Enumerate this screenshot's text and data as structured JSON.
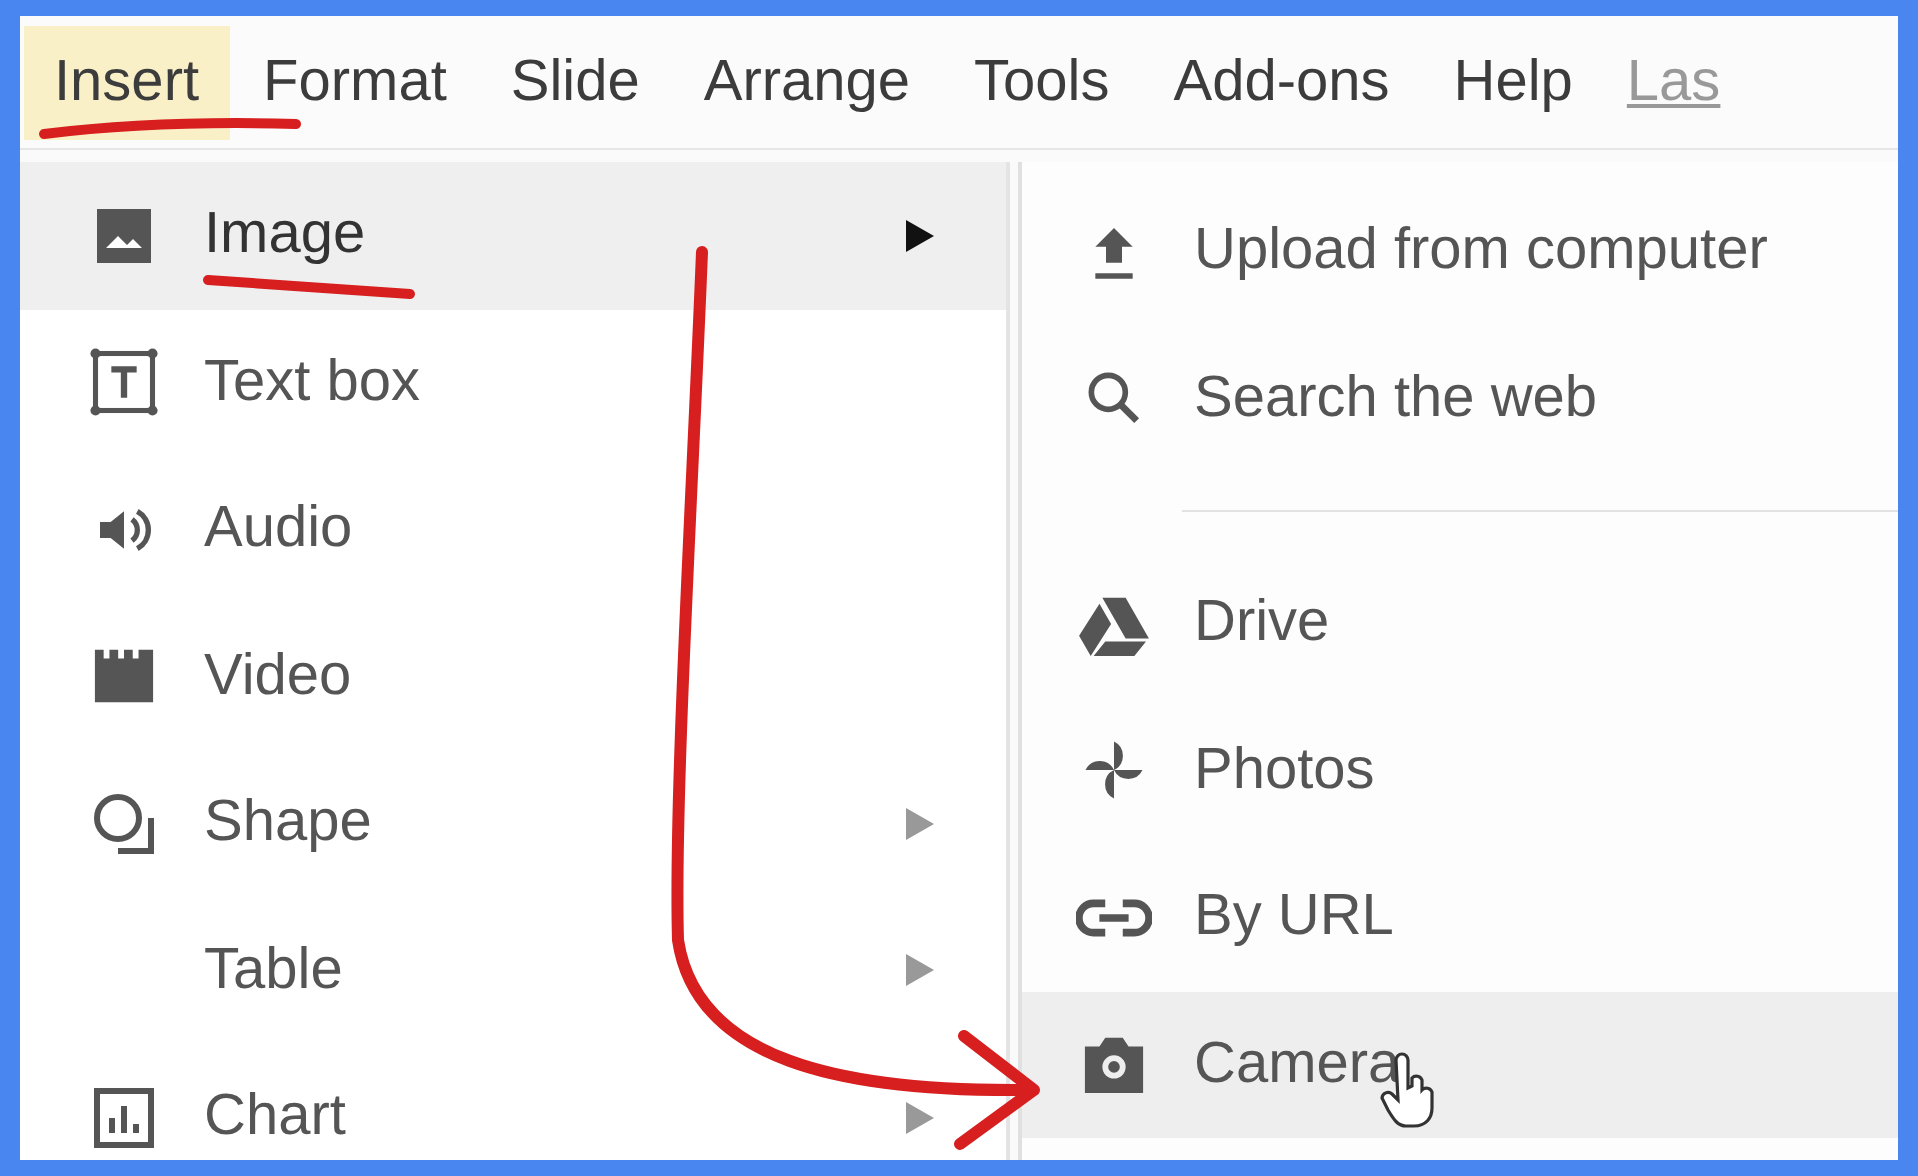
{
  "menubar": [
    {
      "label": "Insert",
      "kind": "menu",
      "selected": true
    },
    {
      "label": "Format",
      "kind": "menu",
      "selected": false
    },
    {
      "label": "Slide",
      "kind": "menu",
      "selected": false
    },
    {
      "label": "Arrange",
      "kind": "menu",
      "selected": false
    },
    {
      "label": "Tools",
      "kind": "menu",
      "selected": false
    },
    {
      "label": "Add-ons",
      "kind": "menu",
      "selected": false
    },
    {
      "label": "Help",
      "kind": "menu",
      "selected": false
    },
    {
      "label": "Las",
      "kind": "link",
      "selected": false
    }
  ],
  "insert_menu": [
    {
      "label": "Image",
      "selected": true,
      "has_submenu": true
    },
    {
      "label": "Text box",
      "selected": false,
      "has_submenu": false
    },
    {
      "label": "Audio",
      "selected": false,
      "has_submenu": false
    },
    {
      "label": "Video",
      "selected": false,
      "has_submenu": false
    },
    {
      "label": "Shape",
      "selected": false,
      "has_submenu": true
    },
    {
      "label": "Table",
      "selected": false,
      "has_submenu": true
    },
    {
      "label": "Chart",
      "selected": false,
      "has_submenu": true
    }
  ],
  "image_submenu": [
    {
      "kind": "item",
      "label": "Upload from computer",
      "selected": false
    },
    {
      "kind": "item",
      "label": "Search the web",
      "selected": false
    },
    {
      "kind": "divider"
    },
    {
      "kind": "item",
      "label": "Drive",
      "selected": false
    },
    {
      "kind": "item",
      "label": "Photos",
      "selected": false
    },
    {
      "kind": "item",
      "label": "By URL",
      "selected": false
    },
    {
      "kind": "item",
      "label": "Camera",
      "selected": true
    }
  ]
}
